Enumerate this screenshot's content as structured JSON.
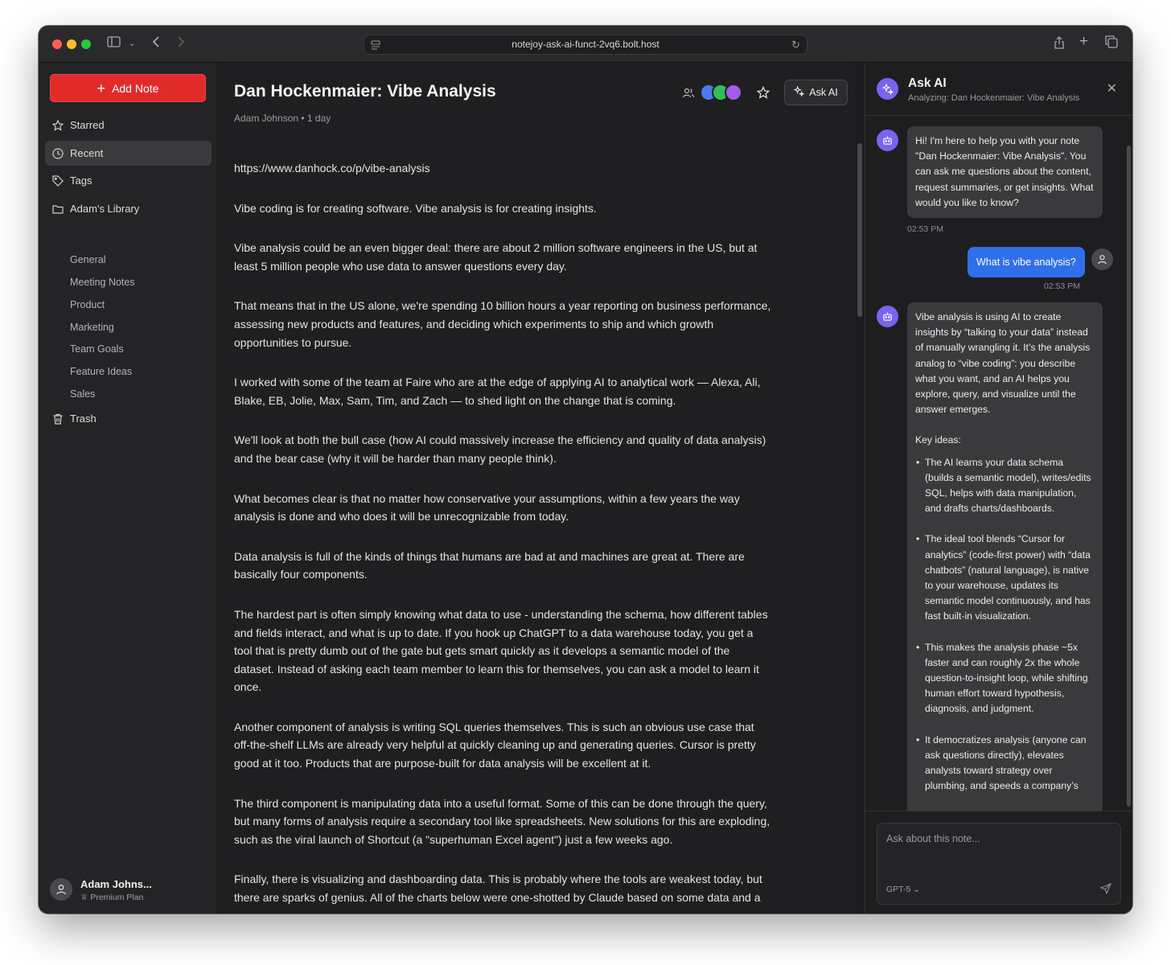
{
  "browser": {
    "url": "notejoy-ask-ai-funct-2vq6.bolt.host"
  },
  "sidebar": {
    "add_note_label": "Add Note",
    "nav": {
      "starred": "Starred",
      "recent": "Recent",
      "tags": "Tags",
      "library": "Adam's Library",
      "trash": "Trash"
    },
    "library_items": [
      "General",
      "Meeting Notes",
      "Product",
      "Marketing",
      "Team Goals",
      "Feature Ideas",
      "Sales"
    ],
    "user": {
      "name": "Adam Johns...",
      "plan": "Premium Plan"
    }
  },
  "note": {
    "title": "Dan Hockenmaier: Vibe Analysis",
    "meta": "Adam Johnson • 1 day",
    "ask_ai_label": "Ask AI",
    "collaborator_colors": [
      "#4b7bf0",
      "#2fbf58",
      "#a45be8"
    ],
    "paragraphs": [
      "https://www.danhock.co/p/vibe-analysis",
      "Vibe coding is for creating software. Vibe analysis is for creating insights.",
      "Vibe analysis could be an even bigger deal: there are about 2 million software engineers in the US, but at least 5 million people who use data to answer questions every day.",
      "That means that in the US alone, we're spending 10 billion hours a year reporting on business performance, assessing new products and features, and deciding which experiments to ship and which growth opportunities to pursue.",
      "I worked with some of the team at Faire who are at the edge of applying AI to analytical work — Alexa, Ali, Blake, EB, Jolie, Max, Sam, Tim, and Zach — to shed light on the change that is coming.",
      "We'll look at both the bull case (how AI could massively increase the efficiency and quality of data analysis) and the bear case (why it will be harder than many people think).",
      "What becomes clear is that no matter how conservative your assumptions, within a few years the way analysis is done and who does it will be unrecognizable from today.",
      "Data analysis is full of the kinds of things that humans are bad at and machines are great at. There are basically four components.",
      "The hardest part is often simply knowing what data to use - understanding the schema, how different tables and fields interact, and what is up to date. If you hook up ChatGPT to a data warehouse today, you get a tool that is pretty dumb out of the gate but gets smart quickly as it develops a semantic model of the dataset. Instead of asking each team member to learn this for themselves, you can ask a model to learn it once.",
      "Another component of analysis is writing SQL queries themselves. This is such an obvious use case that off-the-shelf LLMs are already very helpful at quickly cleaning up and generating queries. Cursor is pretty good at it too. Products that are purpose-built for data analysis will be excellent at it.",
      "The third component is manipulating data into a useful format. Some of this can be done through the query, but many forms of analysis require a secondary tool like spreadsheets. New solutions for this are exploding, such as the viral launch of Shortcut (a \"superhuman Excel agent\") just a few weeks ago.",
      "Finally, there is visualizing and dashboarding data. This is probably where the tools are weakest today, but there are sparks of genius. All of the charts below were one-shotted by Claude based on some data and a"
    ]
  },
  "ai_panel": {
    "title": "Ask AI",
    "subtitle": "Analyzing: Dan Hockenmaier: Vibe Analysis",
    "messages": {
      "greeting": "Hi! I'm here to help you with your note \"Dan Hockenmaier: Vibe Analysis\". You can ask me questions about the content, request summaries, or get insights. What would you like to know?",
      "greeting_time": "02:53 PM",
      "user_question": "What is vibe analysis?",
      "user_time": "02:53 PM",
      "answer_intro": "Vibe analysis is using AI to create insights by “talking to your data” instead of manually wrangling it. It’s the analysis analog to “vibe coding”: you describe what you want, and an AI helps you explore, query, and visualize until the answer emerges.",
      "key_ideas_label": "Key ideas:",
      "bullets": [
        "The AI learns your data schema (builds a semantic model), writes/edits SQL, helps with data manipulation, and drafts charts/dashboards.",
        "The ideal tool blends “Cursor for analytics” (code-first power) with “data chatbots” (natural language), is native to your warehouse, updates its semantic model continuously, and has fast built-in visualization.",
        "This makes the analysis phase ~5x faster and can roughly 2x the whole question-to-insight loop, while shifting human effort toward hypothesis, diagnosis, and judgment.",
        "It democratizes analysis (anyone can ask questions directly), elevates analysts toward strategy over plumbing, and speeds a company’s"
      ]
    },
    "composer": {
      "placeholder": "Ask about this note...",
      "model": "GPT-5"
    }
  }
}
